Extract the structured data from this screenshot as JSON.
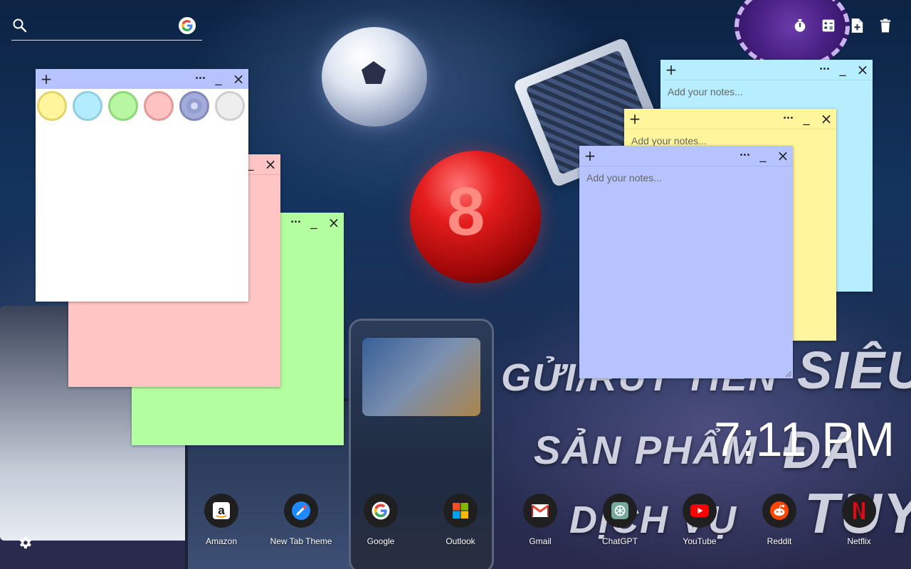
{
  "search": {
    "placeholder": ""
  },
  "toolbar": {
    "icons": [
      "stopwatch-icon",
      "calculator-icon",
      "new-note-icon",
      "trash-icon"
    ]
  },
  "palette_note": {
    "swatches": [
      {
        "name": "yellow",
        "fill": "#fff59d",
        "ring": "#e3d36b"
      },
      {
        "name": "cyan",
        "fill": "#b3ecff",
        "ring": "#8fcfe0"
      },
      {
        "name": "green",
        "fill": "#b9f6a1",
        "ring": "#8fd77b"
      },
      {
        "name": "pink",
        "fill": "#ffc2c2",
        "ring": "#e59a9a"
      },
      {
        "name": "periwinkle",
        "fill": "#a3acd9",
        "ring": "#8089b8",
        "selected": true
      },
      {
        "name": "white",
        "fill": "#eeeeee",
        "ring": "#cfcfcf"
      }
    ]
  },
  "notes": {
    "cyan": {
      "placeholder": "Add your notes...",
      "color": "#b6eeff"
    },
    "yellow": {
      "placeholder": "Add your notes...",
      "color": "#fff59d"
    },
    "blue": {
      "placeholder": "Add your notes...",
      "color": "#b6c3ff"
    },
    "pink": {
      "color": "#ffc4c4"
    },
    "green": {
      "color": "#b3ff9f"
    },
    "white": {
      "color": "#ffffff"
    }
  },
  "note_controls": {
    "add": "+",
    "more": "•••",
    "minimize": "_",
    "close": "×"
  },
  "clock": {
    "time": "7:11 PM"
  },
  "shortcuts": [
    {
      "label": "Amazon",
      "icon": "amazon-icon"
    },
    {
      "label": "New Tab Theme",
      "icon": "new-tab-theme-icon"
    },
    {
      "label": "Google",
      "icon": "google-icon"
    },
    {
      "label": "Outlook",
      "icon": "outlook-icon"
    },
    {
      "label": "Gmail",
      "icon": "gmail-icon"
    },
    {
      "label": "ChatGPT",
      "icon": "chatgpt-icon"
    },
    {
      "label": "YouTube",
      "icon": "youtube-icon"
    },
    {
      "label": "Reddit",
      "icon": "reddit-icon"
    },
    {
      "label": "Netflix",
      "icon": "netflix-icon"
    }
  ],
  "background_text": {
    "line1": "GỬI/RÚT TIỀN",
    "line2": "SẢN PHẨM",
    "line3": "DỊCH VỤ",
    "right1": "SIÊU",
    "right2": "ĐA",
    "right3": "TUY"
  }
}
